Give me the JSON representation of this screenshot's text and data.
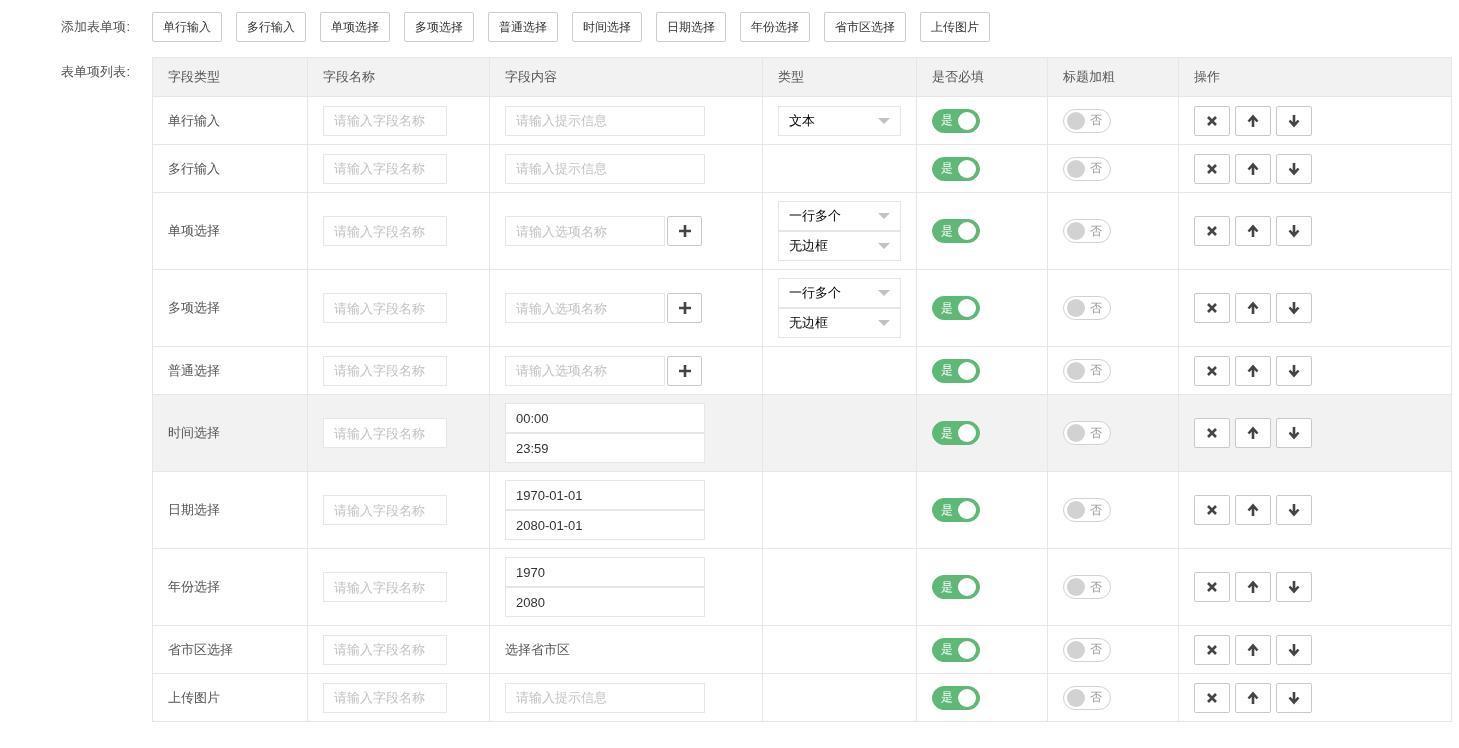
{
  "add_items": {
    "label": "添加表单项:",
    "buttons": [
      "单行输入",
      "多行输入",
      "单项选择",
      "多项选择",
      "普通选择",
      "时间选择",
      "日期选择",
      "年份选择",
      "省市区选择",
      "上传图片"
    ]
  },
  "table": {
    "label": "表单项列表:",
    "columns": [
      "字段类型",
      "字段名称",
      "字段内容",
      "类型",
      "是否必填",
      "标题加粗",
      "操作"
    ],
    "rows": [
      {
        "type": "单行输入",
        "highlighted": false,
        "name_placeholder": "请输入字段名称",
        "content": {
          "kind": "input",
          "placeholder": "请输入提示信息"
        },
        "selects": [
          "文本"
        ],
        "required": {
          "on": true,
          "label": "是"
        },
        "bold": {
          "on": false,
          "label": "否"
        }
      },
      {
        "type": "多行输入",
        "highlighted": false,
        "name_placeholder": "请输入字段名称",
        "content": {
          "kind": "input",
          "placeholder": "请输入提示信息"
        },
        "selects": [],
        "required": {
          "on": true,
          "label": "是"
        },
        "bold": {
          "on": false,
          "label": "否"
        }
      },
      {
        "type": "单项选择",
        "highlighted": false,
        "name_placeholder": "请输入字段名称",
        "content": {
          "kind": "option",
          "placeholder": "请输入选项名称"
        },
        "selects": [
          "一行多个",
          "无边框"
        ],
        "required": {
          "on": true,
          "label": "是"
        },
        "bold": {
          "on": false,
          "label": "否"
        }
      },
      {
        "type": "多项选择",
        "highlighted": false,
        "name_placeholder": "请输入字段名称",
        "content": {
          "kind": "option",
          "placeholder": "请输入选项名称"
        },
        "selects": [
          "一行多个",
          "无边框"
        ],
        "required": {
          "on": true,
          "label": "是"
        },
        "bold": {
          "on": false,
          "label": "否"
        }
      },
      {
        "type": "普通选择",
        "highlighted": false,
        "name_placeholder": "请输入字段名称",
        "content": {
          "kind": "option",
          "placeholder": "请输入选项名称"
        },
        "selects": [],
        "required": {
          "on": true,
          "label": "是"
        },
        "bold": {
          "on": false,
          "label": "否"
        }
      },
      {
        "type": "时间选择",
        "highlighted": true,
        "name_placeholder": "请输入字段名称",
        "content": {
          "kind": "range",
          "values": [
            "00:00",
            "23:59"
          ]
        },
        "selects": [],
        "required": {
          "on": true,
          "label": "是"
        },
        "bold": {
          "on": false,
          "label": "否"
        }
      },
      {
        "type": "日期选择",
        "highlighted": false,
        "name_placeholder": "请输入字段名称",
        "content": {
          "kind": "range",
          "values": [
            "1970-01-01",
            "2080-01-01"
          ]
        },
        "selects": [],
        "required": {
          "on": true,
          "label": "是"
        },
        "bold": {
          "on": false,
          "label": "否"
        }
      },
      {
        "type": "年份选择",
        "highlighted": false,
        "name_placeholder": "请输入字段名称",
        "content": {
          "kind": "range",
          "values": [
            "1970",
            "2080"
          ]
        },
        "selects": [],
        "required": {
          "on": true,
          "label": "是"
        },
        "bold": {
          "on": false,
          "label": "否"
        }
      },
      {
        "type": "省市区选择",
        "highlighted": false,
        "name_placeholder": "请输入字段名称",
        "content": {
          "kind": "text",
          "text": "选择省市区"
        },
        "selects": [],
        "required": {
          "on": true,
          "label": "是"
        },
        "bold": {
          "on": false,
          "label": "否"
        }
      },
      {
        "type": "上传图片",
        "highlighted": false,
        "name_placeholder": "请输入字段名称",
        "content": {
          "kind": "input",
          "placeholder": "请输入提示信息"
        },
        "selects": [],
        "required": {
          "on": true,
          "label": "是"
        },
        "bold": {
          "on": false,
          "label": "否"
        }
      }
    ]
  }
}
